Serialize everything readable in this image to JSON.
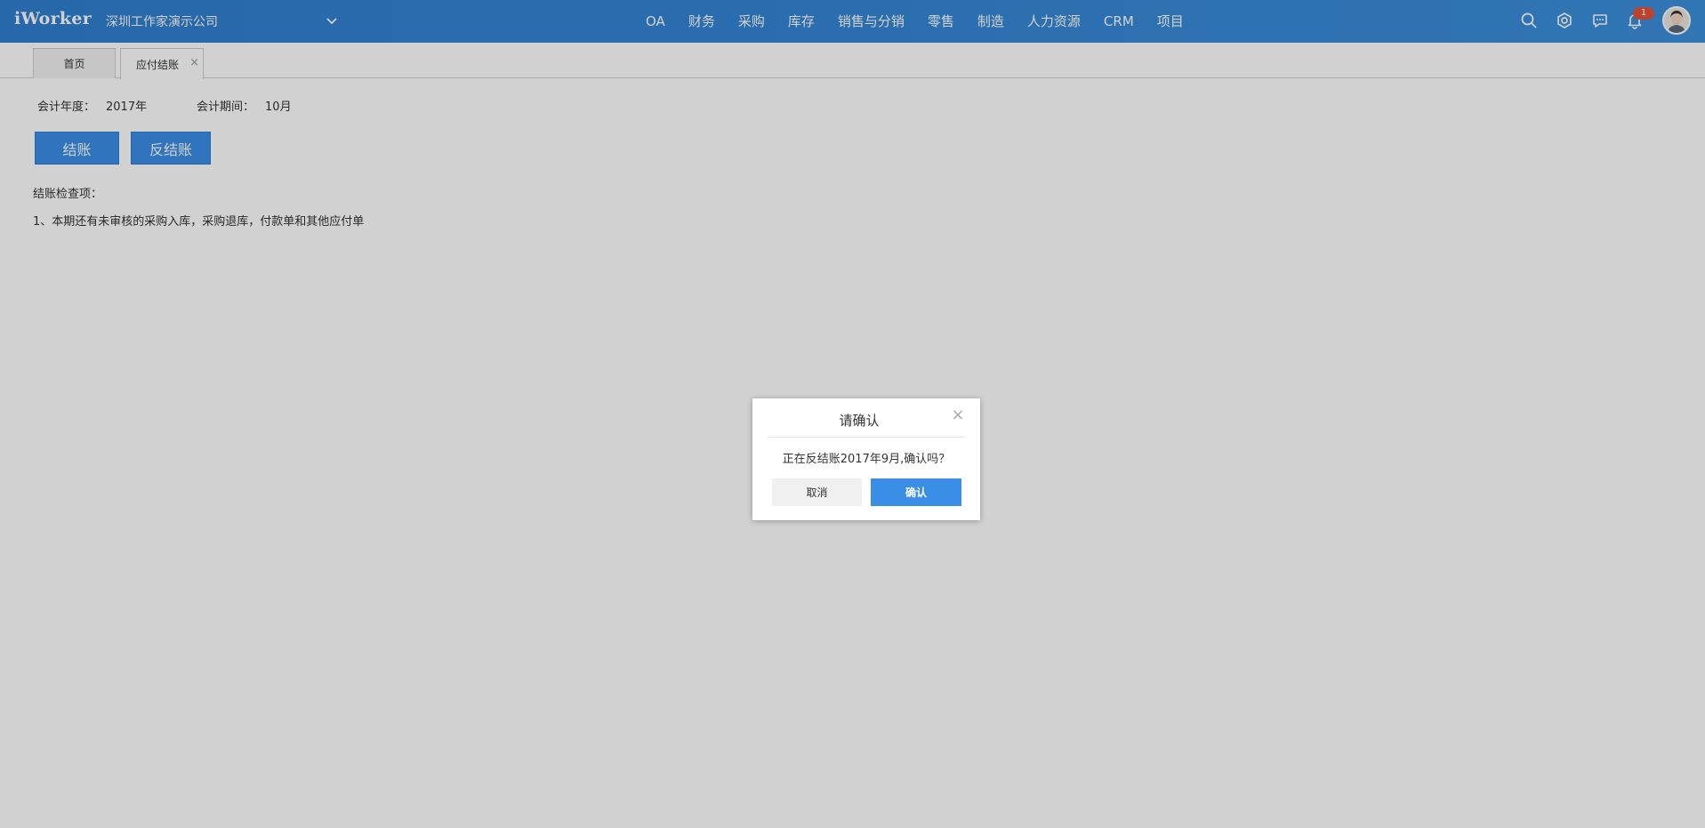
{
  "header": {
    "logo": "iWorker",
    "company": "深圳工作家演示公司",
    "nav": [
      "OA",
      "财务",
      "采购",
      "库存",
      "销售与分销",
      "零售",
      "制造",
      "人力资源",
      "CRM",
      "项目"
    ],
    "notification_count": "1",
    "icons": [
      "search-icon",
      "gear-icon",
      "chat-icon",
      "bell-icon",
      "avatar"
    ]
  },
  "tabs": {
    "home": "首页",
    "active": "应付结账",
    "close_glyph": "×"
  },
  "content": {
    "year_label": "会计年度：",
    "year_value": "2017年",
    "period_label": "会计期间：",
    "period_value": "10月",
    "close_button": "结账",
    "unclose_button": "反结账",
    "check_title": "结账检查项：",
    "check_items": [
      "1、本期还有未审核的采购入库，采购退库，付款单和其他应付单"
    ]
  },
  "dialog": {
    "title": "请确认",
    "message": "正在反结账2017年9月,确认吗？",
    "cancel": "取消",
    "confirm": "确认",
    "close_glyph": "×"
  },
  "colors": {
    "header": "#3386d6",
    "primary": "#3a8ee6",
    "badge": "#e4533b"
  }
}
